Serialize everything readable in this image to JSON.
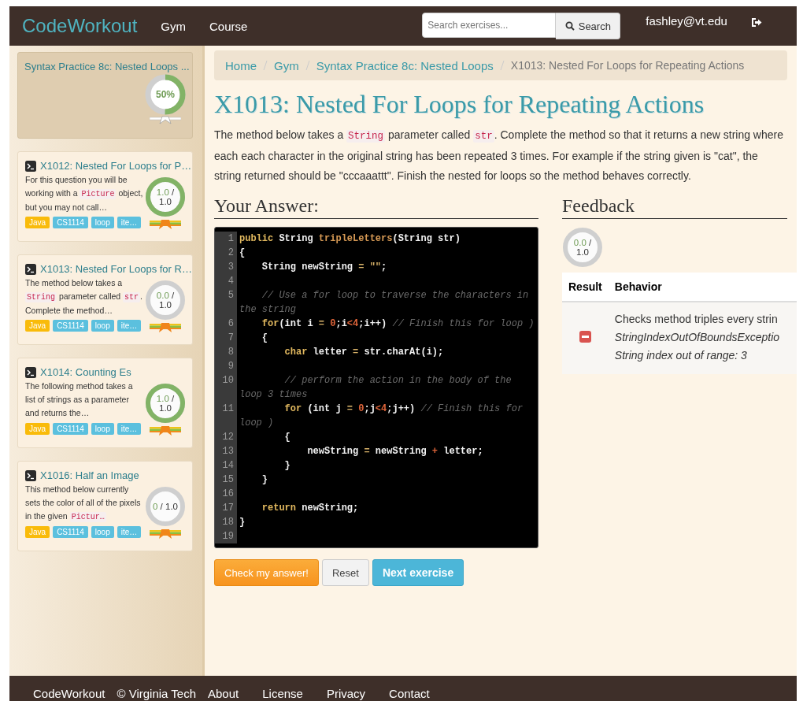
{
  "navbar": {
    "brand": "CodeWorkout",
    "links": [
      "Gym",
      "Course"
    ],
    "search": {
      "placeholder": "Search exercises...",
      "button": "Search"
    },
    "user": "fashley@vt.edu"
  },
  "sidebar": {
    "header": {
      "title": "Syntax Practice 8c: Nested Loops ...",
      "score": "50%",
      "level": 0.5
    },
    "exercises": [
      {
        "title": "X1012: Nested For Loops for P…",
        "description": [
          {
            "text": "For this question you will be working with a ",
            "code": false
          },
          {
            "text": "Picture",
            "code": true
          },
          {
            "text": " object, but you may not call…",
            "code": false
          }
        ],
        "tags": [
          {
            "label": "Java",
            "color": "#f9bb0a"
          },
          {
            "label": "CS1114",
            "color": "#5bc0de"
          },
          {
            "label": "loop",
            "color": "#5bc0de"
          },
          {
            "label": "ite…",
            "color": "#5bc0de"
          }
        ],
        "score": "1.0",
        "max": "/ 1.0",
        "level": 1
      },
      {
        "title": "X1013: Nested For Loops for R…",
        "description": [
          {
            "text": "The method below takes a ",
            "code": false
          },
          {
            "text": "String",
            "code": true
          },
          {
            "text": " parameter called ",
            "code": false
          },
          {
            "text": "str",
            "code": true
          },
          {
            "text": ". Complete the method…",
            "code": false
          }
        ],
        "tags": [
          {
            "label": "Java",
            "color": "#f9bb0a"
          },
          {
            "label": "CS1114",
            "color": "#5bc0de"
          },
          {
            "label": "loop",
            "color": "#5bc0de"
          },
          {
            "label": "ite…",
            "color": "#5bc0de"
          }
        ],
        "score": "0.0",
        "max": "/ 1.0",
        "level": 0
      },
      {
        "title": "X1014: Counting Es",
        "description": [
          {
            "text": "The following method takes a list of strings as a parameter and returns the…",
            "code": false
          }
        ],
        "tags": [
          {
            "label": "Java",
            "color": "#f9bb0a"
          },
          {
            "label": "CS1114",
            "color": "#5bc0de"
          },
          {
            "label": "loop",
            "color": "#5bc0de"
          },
          {
            "label": "ite…",
            "color": "#5bc0de"
          }
        ],
        "score": "1.0",
        "max": "/ 1.0",
        "level": 1
      },
      {
        "title": "X1016: Half an Image",
        "description": [
          {
            "text": "This method below currently sets the color of all of the pixels in the given ",
            "code": false
          },
          {
            "text": "Pictur…",
            "code": true
          }
        ],
        "tags": [
          {
            "label": "Java",
            "color": "#f9bb0a"
          },
          {
            "label": "CS1114",
            "color": "#5bc0de"
          },
          {
            "label": "loop",
            "color": "#5bc0de"
          },
          {
            "label": "ite…",
            "color": "#5bc0de"
          }
        ],
        "score": "0",
        "max": "/ 1.0",
        "level": 0
      }
    ]
  },
  "breadcrumb": [
    {
      "label": "Home",
      "current": false
    },
    {
      "label": "Gym",
      "current": false
    },
    {
      "label": "Syntax Practice 8c: Nested Loops",
      "current": false
    },
    {
      "label": "X1013: Nested For Loops for Repeating Actions",
      "current": true
    }
  ],
  "title": "X1013: Nested For Loops for Repeating Actions",
  "prompt": [
    {
      "text": "The method below takes a ",
      "code": false
    },
    {
      "text": "String",
      "code": true
    },
    {
      "text": " parameter called ",
      "code": false
    },
    {
      "text": "str",
      "code": true
    },
    {
      "text": ". Complete the method so that it returns a new string where each each character in the original string has been repeated 3 times. For example if the string given is \"cat\", the string returned should be \"cccaaattt\". Finish the nested for loops so the method behaves correctly.",
      "code": false
    }
  ],
  "answer": {
    "heading": "Your Answer:",
    "code": [
      {
        "number": "1",
        "tokens": [
          {
            "kind": "keyword",
            "text": "public "
          },
          {
            "kind": "plain",
            "text": "String "
          },
          {
            "kind": "function",
            "text": "tripleLetters"
          },
          {
            "kind": "plain",
            "text": "(String str)"
          }
        ]
      },
      {
        "number": "2",
        "tokens": [
          {
            "kind": "plain",
            "text": "{"
          }
        ]
      },
      {
        "number": "3",
        "tokens": [
          {
            "kind": "plain",
            "text": "    String newString "
          },
          {
            "kind": "operator",
            "text": "= \"\""
          },
          {
            "kind": "plain",
            "text": ";"
          }
        ]
      },
      {
        "number": "4"
      },
      {
        "number": "5",
        "tokens": [
          {
            "kind": "comment",
            "text": "    // Use a for loop to traverse the characters in the string"
          }
        ]
      },
      {
        "number": "6",
        "tokens": [
          {
            "kind": "keyword",
            "text": "    for"
          },
          {
            "kind": "plain",
            "text": "(int i "
          },
          {
            "kind": "operator",
            "text": "= "
          },
          {
            "kind": "number",
            "text": "0"
          },
          {
            "kind": "plain",
            "text": ";i"
          },
          {
            "kind": "number",
            "text": "<4"
          },
          {
            "kind": "plain",
            "text": ";i++) "
          },
          {
            "kind": "comment",
            "text": "// Finish this for loop )"
          }
        ]
      },
      {
        "number": "7",
        "tokens": [
          {
            "kind": "plain",
            "text": "    {"
          }
        ]
      },
      {
        "number": "8",
        "tokens": [
          {
            "kind": "keyword",
            "text": "        char"
          },
          {
            "kind": "plain",
            "text": " letter "
          },
          {
            "kind": "operator",
            "text": "="
          },
          {
            "kind": "plain",
            "text": " str.charAt(i);"
          }
        ]
      },
      {
        "number": "9"
      },
      {
        "number": "10",
        "tokens": [
          {
            "kind": "comment",
            "text": "        // perform the action in the body of the loop 3 times"
          }
        ]
      },
      {
        "number": "11",
        "tokens": [
          {
            "kind": "keyword",
            "text": "        for"
          },
          {
            "kind": "plain",
            "text": " (int j "
          },
          {
            "kind": "operator",
            "text": "= "
          },
          {
            "kind": "number",
            "text": "0"
          },
          {
            "kind": "plain",
            "text": ";j"
          },
          {
            "kind": "number",
            "text": "<4"
          },
          {
            "kind": "plain",
            "text": ";j++) "
          },
          {
            "kind": "comment",
            "text": "// Finish this for loop )"
          }
        ]
      },
      {
        "number": "12",
        "tokens": [
          {
            "kind": "plain",
            "text": "        {"
          }
        ]
      },
      {
        "number": "13",
        "tokens": [
          {
            "kind": "plain",
            "text": "            newString "
          },
          {
            "kind": "operator",
            "text": "="
          },
          {
            "kind": "plain",
            "text": " newString "
          },
          {
            "kind": "number",
            "text": "+"
          },
          {
            "kind": "plain",
            "text": " letter;"
          }
        ]
      },
      {
        "number": "14",
        "tokens": [
          {
            "kind": "plain",
            "text": "        }"
          }
        ]
      },
      {
        "number": "15",
        "tokens": [
          {
            "kind": "plain",
            "text": "    }"
          }
        ]
      },
      {
        "number": "16"
      },
      {
        "number": "17",
        "tokens": [
          {
            "kind": "keyword",
            "text": "    return"
          },
          {
            "kind": "plain",
            "text": " newString;"
          }
        ]
      },
      {
        "number": "18",
        "tokens": [
          {
            "kind": "plain",
            "text": "}"
          }
        ]
      },
      {
        "number": "19"
      }
    ],
    "buttons": [
      {
        "label": "Check my answer!",
        "kind": "primary"
      },
      {
        "label": "Reset",
        "kind": "default"
      },
      {
        "label": "Next exercise",
        "kind": "next"
      }
    ]
  },
  "feedback": {
    "heading": "Feedback",
    "score": "0.0",
    "max": "/ 1.0",
    "level": 0,
    "columns": [
      "Result",
      "Behavior"
    ],
    "rows": [
      {
        "passed": false,
        "lines": [
          "Checks method triples every strin",
          "StringIndexOutOfBoundsExceptio",
          "String index out of range: 3"
        ]
      }
    ]
  },
  "footer": [
    "CodeWorkout",
    "© Virginia Tech",
    "About",
    "License",
    "Privacy",
    "Contact"
  ]
}
